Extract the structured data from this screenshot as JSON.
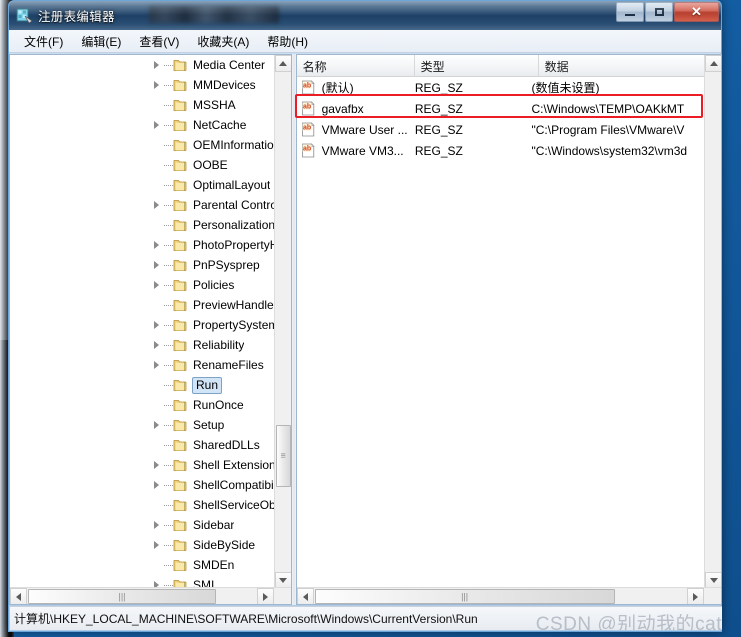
{
  "window": {
    "title": "注册表编辑器",
    "icon": "registry-editor-icon",
    "controls": {
      "minimize": "最小化",
      "maximize": "最大化",
      "close": "✕"
    }
  },
  "menubar": {
    "items": [
      {
        "label": "文件(F)",
        "name": "menu-file"
      },
      {
        "label": "编辑(E)",
        "name": "menu-edit"
      },
      {
        "label": "查看(V)",
        "name": "menu-view"
      },
      {
        "label": "收藏夹(A)",
        "name": "menu-favorites"
      },
      {
        "label": "帮助(H)",
        "name": "menu-help"
      }
    ]
  },
  "tree": {
    "nodes": [
      {
        "label": "Media Center",
        "expandable": true,
        "selected": false
      },
      {
        "label": "MMDevices",
        "expandable": true,
        "selected": false
      },
      {
        "label": "MSSHA",
        "expandable": false,
        "selected": false
      },
      {
        "label": "NetCache",
        "expandable": true,
        "selected": false
      },
      {
        "label": "OEMInformation",
        "expandable": false,
        "selected": false
      },
      {
        "label": "OOBE",
        "expandable": false,
        "selected": false
      },
      {
        "label": "OptimalLayout",
        "expandable": false,
        "selected": false
      },
      {
        "label": "Parental Controls",
        "expandable": true,
        "selected": false
      },
      {
        "label": "Personalization",
        "expandable": false,
        "selected": false
      },
      {
        "label": "PhotoPropertyHar",
        "expandable": true,
        "selected": false
      },
      {
        "label": "PnPSysprep",
        "expandable": true,
        "selected": false
      },
      {
        "label": "Policies",
        "expandable": true,
        "selected": false
      },
      {
        "label": "PreviewHandlers",
        "expandable": false,
        "selected": false
      },
      {
        "label": "PropertySystem",
        "expandable": true,
        "selected": false
      },
      {
        "label": "Reliability",
        "expandable": true,
        "selected": false
      },
      {
        "label": "RenameFiles",
        "expandable": true,
        "selected": false
      },
      {
        "label": "Run",
        "expandable": false,
        "selected": true
      },
      {
        "label": "RunOnce",
        "expandable": false,
        "selected": false
      },
      {
        "label": "Setup",
        "expandable": true,
        "selected": false
      },
      {
        "label": "SharedDLLs",
        "expandable": false,
        "selected": false
      },
      {
        "label": "Shell Extensions",
        "expandable": true,
        "selected": false
      },
      {
        "label": "ShellCompatibility",
        "expandable": true,
        "selected": false
      },
      {
        "label": "ShellServiceObjec",
        "expandable": false,
        "selected": false
      },
      {
        "label": "Sidebar",
        "expandable": true,
        "selected": false
      },
      {
        "label": "SideBySide",
        "expandable": true,
        "selected": false
      },
      {
        "label": "SMDEn",
        "expandable": false,
        "selected": false
      },
      {
        "label": "SMI",
        "expandable": true,
        "selected": false
      }
    ]
  },
  "list": {
    "columns": [
      {
        "label": "名称",
        "name": "column-name"
      },
      {
        "label": "类型",
        "name": "column-type"
      },
      {
        "label": "数据",
        "name": "column-data"
      }
    ],
    "rows": [
      {
        "name": "(默认)",
        "type": "REG_SZ",
        "data": "(数值未设置)",
        "icon": "string-value-icon",
        "highlighted": false
      },
      {
        "name": "gavafbx",
        "type": "REG_SZ",
        "data": "C:\\Windows\\TEMP\\OAKkMT",
        "icon": "string-value-icon",
        "highlighted": true
      },
      {
        "name": "VMware User ...",
        "type": "REG_SZ",
        "data": "\"C:\\Program Files\\VMware\\V",
        "icon": "string-value-icon",
        "highlighted": false
      },
      {
        "name": "VMware VM3...",
        "type": "REG_SZ",
        "data": "\"C:\\Windows\\system32\\vm3d",
        "icon": "string-value-icon",
        "highlighted": false
      }
    ]
  },
  "statusbar": {
    "path": "计算机\\HKEY_LOCAL_MACHINE\\SOFTWARE\\Microsoft\\Windows\\CurrentVersion\\Run",
    "watermark": "CSDN @别动我的cat"
  },
  "colors": {
    "highlight_border": "#ec1c24",
    "selection_fill": "#d2e5f7",
    "selection_border": "#7da2c6",
    "desktop": "#1461a8",
    "titlebar": "#22456a"
  }
}
